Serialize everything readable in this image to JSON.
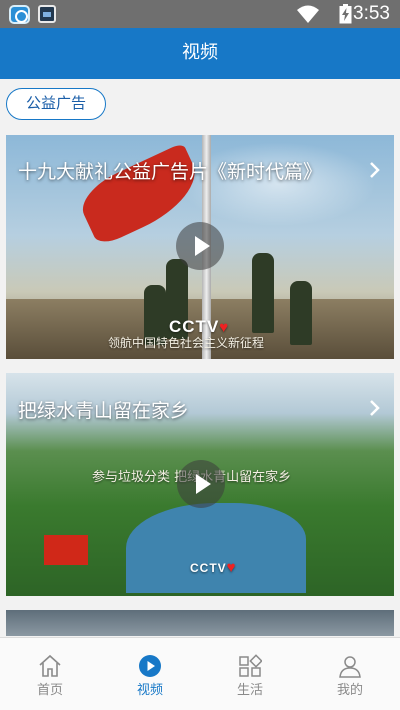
{
  "status_bar": {
    "time": "3:53",
    "icons": [
      "app-icon-browser",
      "app-icon-gallery",
      "wifi-icon",
      "battery-charging-icon"
    ]
  },
  "header": {
    "title": "视频"
  },
  "category": {
    "label": "公益广告"
  },
  "videos": [
    {
      "title": "十九大献礼公益广告片《新时代篇》",
      "logo_text": "CCTV",
      "caption": "领航中国特色社会主义新征程"
    },
    {
      "title": "把绿水青山留在家乡",
      "logo_text": "CCTV",
      "caption": "参与垃圾分类 把绿水青山留在家乡"
    }
  ],
  "tabbar": {
    "active_index": 1,
    "items": [
      {
        "label": "首页",
        "icon": "home-icon"
      },
      {
        "label": "视频",
        "icon": "play-circle-icon"
      },
      {
        "label": "生活",
        "icon": "grid-icon"
      },
      {
        "label": "我的",
        "icon": "user-icon"
      }
    ]
  },
  "colors": {
    "primary": "#1778c7",
    "inactive": "#8a8a8a"
  }
}
